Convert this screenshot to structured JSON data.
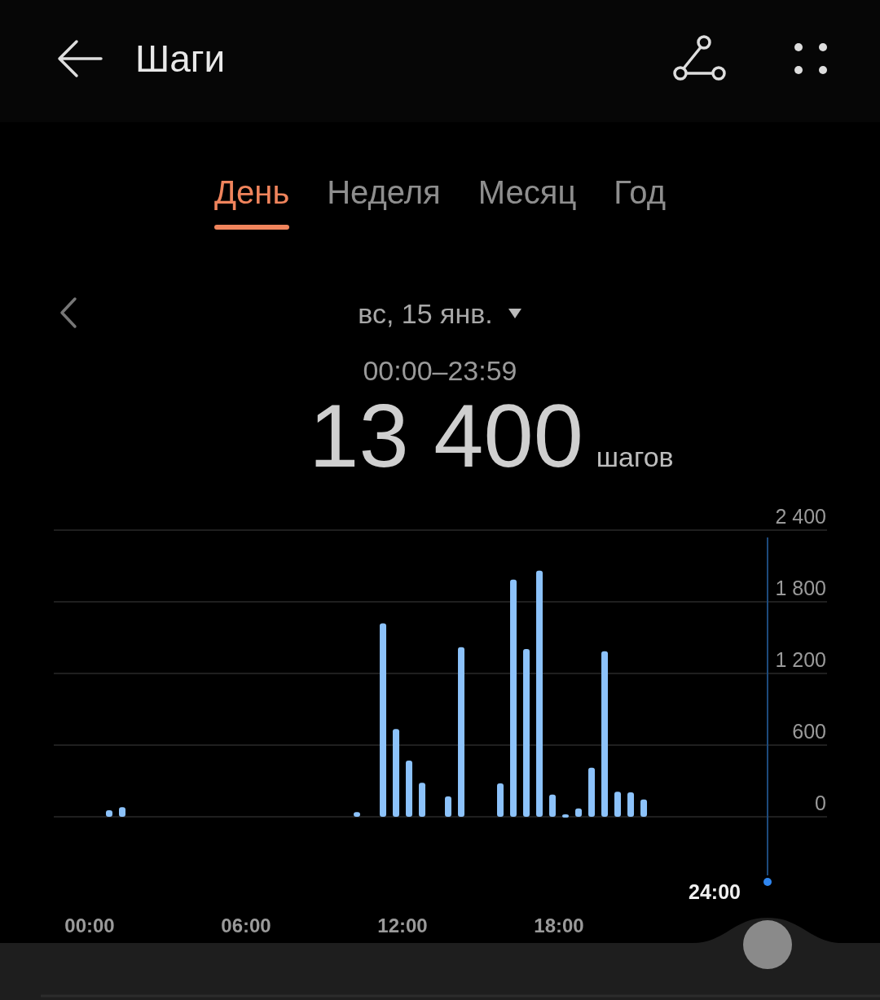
{
  "header": {
    "title": "Шаги"
  },
  "tabs": [
    {
      "label": "День",
      "selected": true
    },
    {
      "label": "Неделя",
      "selected": false
    },
    {
      "label": "Месяц",
      "selected": false
    },
    {
      "label": "Год",
      "selected": false
    }
  ],
  "date": {
    "label": "вс, 15 янв."
  },
  "time_range": "00:00–23:59",
  "total": {
    "value": "13 400",
    "unit": "шагов"
  },
  "chart": {
    "cursor_label": "24:00",
    "chart_data": {
      "type": "bar",
      "x": [
        0.75,
        1.25,
        10.25,
        11.25,
        11.75,
        12.25,
        12.75,
        13.75,
        14.25,
        15.75,
        16.25,
        16.75,
        17.25,
        17.75,
        18.25,
        18.75,
        19.25,
        19.75,
        20.25,
        20.75,
        21.25
      ],
      "values": [
        55,
        80,
        40,
        1620,
        735,
        470,
        285,
        170,
        1420,
        280,
        1985,
        1405,
        2060,
        185,
        20,
        70,
        410,
        1385,
        210,
        205,
        145
      ],
      "ylim": [
        0,
        2400
      ],
      "xlim": [
        -1.375,
        28.28
      ],
      "grid": true,
      "yticks": [
        {
          "value": 0,
          "label": "0"
        },
        {
          "value": 600,
          "label": "600"
        },
        {
          "value": 1200,
          "label": "1 200"
        },
        {
          "value": 1800,
          "label": "1 800"
        },
        {
          "value": 2400,
          "label": "2 400"
        }
      ],
      "xticks": [
        {
          "value": 0,
          "label": "00:00"
        },
        {
          "value": 6,
          "label": "06:00"
        },
        {
          "value": 12,
          "label": "12:00"
        },
        {
          "value": 18,
          "label": "18:00"
        }
      ]
    }
  }
}
